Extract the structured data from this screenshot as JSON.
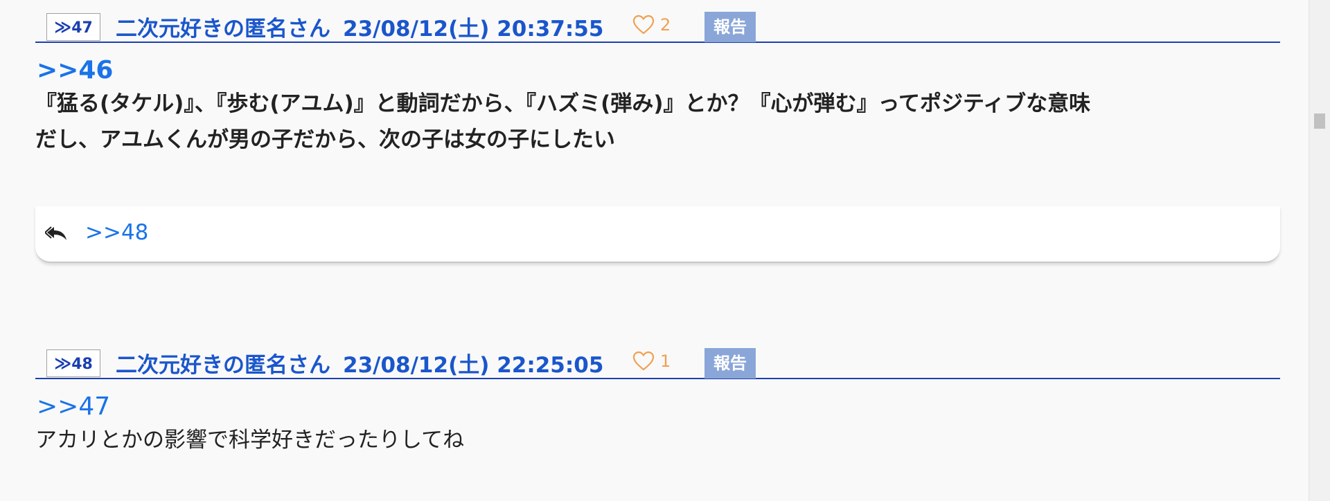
{
  "posts": [
    {
      "res_label": "≫",
      "res_number": "47",
      "author": "二次元好きの匿名さん",
      "date": "23/08/12(土) 20:37:55",
      "like_count": "2",
      "report_label": "報告",
      "anchor": ">>46",
      "body_lines": [
        "『猛る(タケル)』、『歩む(アユム)』と動詞だから、『ハズミ(弾み)』とか？『心が弾む』ってポジティブな意味",
        "だし、アユムくんが男の子だから、次の子は女の子にしたい"
      ],
      "reply_link": ">>48"
    },
    {
      "res_label": "≫",
      "res_number": "48",
      "author": "二次元好きの匿名さん",
      "date": "23/08/12(土) 22:25:05",
      "like_count": "1",
      "report_label": "報告",
      "anchor": ">>47",
      "body_lines": [
        "アカリとかの影響で科学好きだったりしてね"
      ]
    }
  ],
  "icons": {
    "like": "heart-outline-icon",
    "reply": "reply-all-icon"
  },
  "colors": {
    "accent_blue": "#1a56cc",
    "link_blue": "#1a73e8",
    "like_orange": "#f0a050",
    "report_bg": "#8aa6d8",
    "divider": "#1a3fb0"
  }
}
